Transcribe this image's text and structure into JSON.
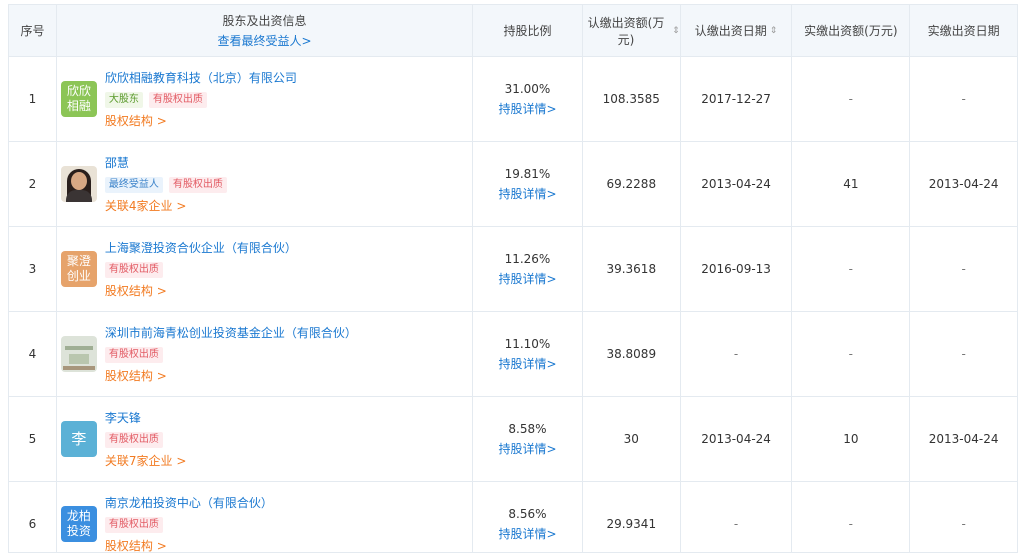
{
  "header": {
    "index": "序号",
    "info_title": "股东及出资信息",
    "info_link": "查看最终受益人>",
    "ratio": "持股比例",
    "amount": "认缴出资额(万元)",
    "date": "认缴出资日期",
    "paid": "实缴出资额(万元)",
    "paid_date": "实缴出资日期",
    "sort_glyph": "⇕"
  },
  "labels": {
    "detail": "持股详情>"
  },
  "rows": [
    {
      "index": "1",
      "avatar_text": "欣欣相融",
      "name": "欣欣相融教育科技（北京）有限公司",
      "tags": [
        "大股东",
        "有股权出质"
      ],
      "link": "股权结构 >",
      "ratio": "31.00%",
      "amount": "108.3585",
      "date": "2017-12-27",
      "paid": "-",
      "paid_date": "-"
    },
    {
      "index": "2",
      "avatar_text": "",
      "name": "邵慧",
      "tags": [
        "最终受益人",
        "有股权出质"
      ],
      "link": "关联4家企业 >",
      "ratio": "19.81%",
      "amount": "69.2288",
      "date": "2013-04-24",
      "paid": "41",
      "paid_date": "2013-04-24"
    },
    {
      "index": "3",
      "avatar_text": "聚澄创业",
      "name": "上海聚澄投资合伙企业（有限合伙）",
      "tags": [
        "有股权出质"
      ],
      "link": "股权结构 >",
      "ratio": "11.26%",
      "amount": "39.3618",
      "date": "2016-09-13",
      "paid": "-",
      "paid_date": "-"
    },
    {
      "index": "4",
      "avatar_text": "",
      "name": "深圳市前海青松创业投资基金企业（有限合伙）",
      "tags": [
        "有股权出质"
      ],
      "link": "股权结构 >",
      "ratio": "11.10%",
      "amount": "38.8089",
      "date": "-",
      "paid": "-",
      "paid_date": "-"
    },
    {
      "index": "5",
      "avatar_text": "李",
      "name": "李天锋",
      "tags": [
        "有股权出质"
      ],
      "link": "关联7家企业 >",
      "ratio": "8.58%",
      "amount": "30",
      "date": "2013-04-24",
      "paid": "10",
      "paid_date": "2013-04-24"
    },
    {
      "index": "6",
      "avatar_text": "龙柏投资",
      "name": "南京龙柏投资中心（有限合伙）",
      "tags": [
        "有股权出质"
      ],
      "link": "股权结构 >",
      "ratio": "8.56%",
      "amount": "29.9341",
      "date": "-",
      "paid": "-",
      "paid_date": "-"
    }
  ],
  "colors": {
    "link": "#1a78d0",
    "orange_link": "#f27b22",
    "pledge_tag": "#e25a63",
    "header_bg": "#f3f7fb"
  }
}
